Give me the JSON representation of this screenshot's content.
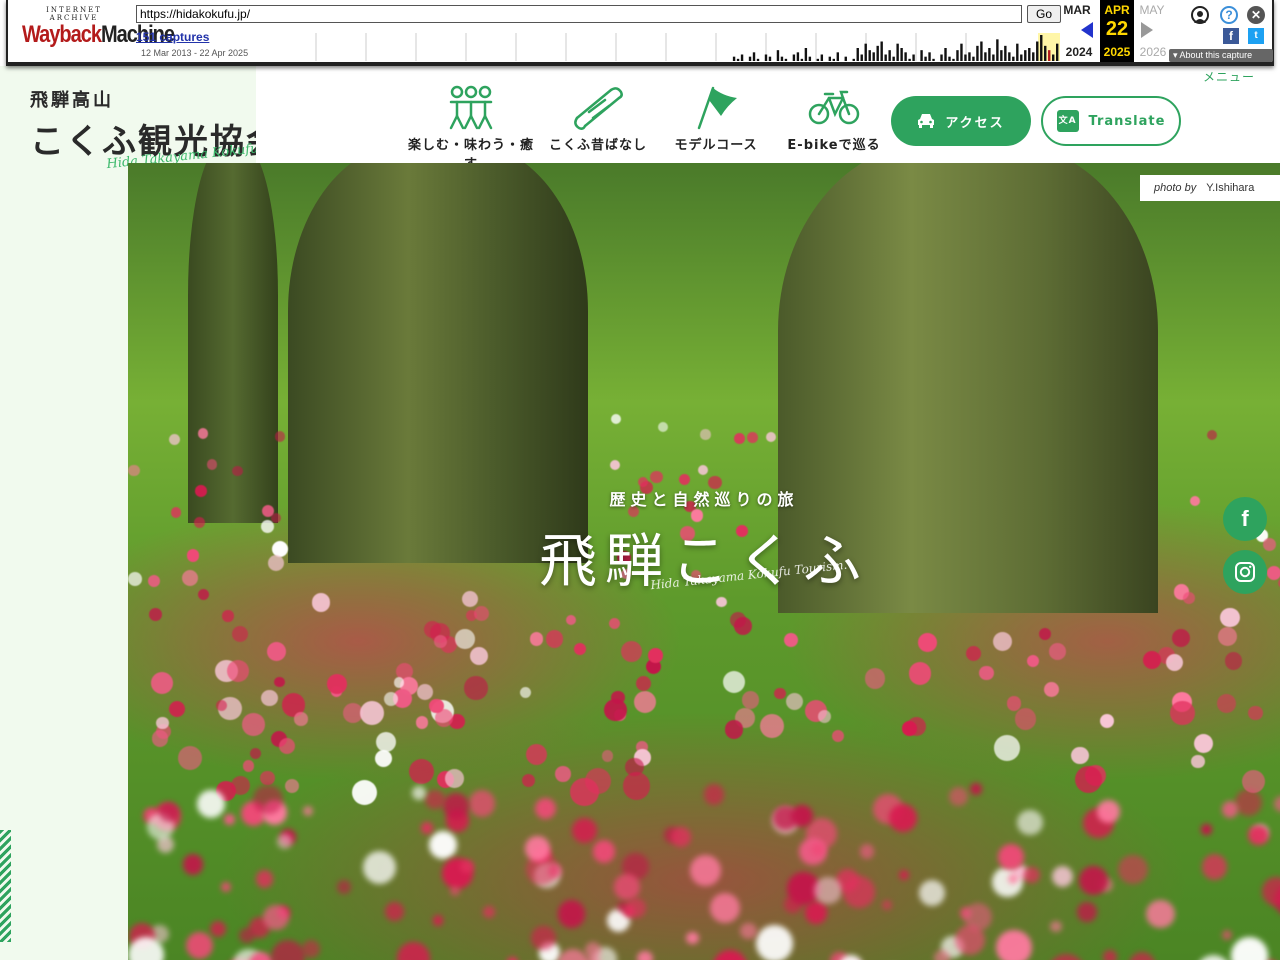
{
  "wayback": {
    "logo_top": "INTERNET ARCHIVE",
    "logo_main_a": "Wayback",
    "logo_main_b": "Machine",
    "url": "https://hidakokufu.jp/",
    "go_label": "Go",
    "captures": "151 captures",
    "range": "12 Mar 2013 - 22 Apr 2025",
    "prev_month": "MAR",
    "cur_month": "APR",
    "next_month": "MAY",
    "prev_year": "2024",
    "cur_year": "2025",
    "next_year": "2026",
    "cur_day": "22",
    "about": "About this capture",
    "sparkline": [
      0,
      0,
      0,
      0,
      0,
      0,
      0,
      0,
      0,
      0,
      0,
      0,
      0,
      0,
      0,
      0,
      0,
      0,
      0,
      0,
      0,
      0,
      0,
      0,
      0,
      0,
      0,
      0,
      0,
      0,
      0,
      0,
      0,
      0,
      0,
      0,
      0,
      0,
      0,
      0,
      0,
      0,
      0,
      0,
      0,
      0,
      0,
      0,
      0,
      0,
      0,
      0,
      0,
      0,
      0,
      0,
      0,
      0,
      0,
      0,
      0,
      0,
      0,
      0,
      0,
      0,
      0,
      0,
      0,
      0,
      0,
      0,
      0,
      0,
      0,
      0,
      0,
      0,
      0,
      0,
      0,
      0,
      0,
      0,
      0,
      0,
      0,
      0,
      0,
      0,
      0,
      0,
      0,
      0,
      0,
      0,
      0,
      0,
      0,
      0,
      0,
      0,
      0,
      0,
      0,
      0,
      2,
      1,
      3,
      0,
      2,
      4,
      1,
      0,
      3,
      2,
      0,
      5,
      2,
      1,
      0,
      3,
      4,
      1,
      6,
      2,
      0,
      1,
      3,
      0,
      2,
      1,
      4,
      0,
      2,
      0,
      1,
      6,
      3,
      8,
      5,
      4,
      7,
      9,
      3,
      5,
      2,
      8,
      6,
      4,
      1,
      3,
      0,
      5,
      2,
      4,
      1,
      0,
      3,
      6,
      2,
      1,
      5,
      8,
      3,
      4,
      2,
      7,
      9,
      4,
      6,
      3,
      10,
      5,
      7,
      4,
      2,
      8,
      3,
      5,
      6,
      4,
      9,
      12,
      7,
      5,
      3,
      8
    ],
    "colors": {
      "accent": "#ffd700",
      "link": "#2233aa",
      "logo_red": "#b31b1b"
    }
  },
  "site": {
    "logo_line1": "飛騨高山",
    "logo_line2": "こくふ観光協会",
    "logo_en": "Hida Takayama Kokufu Tourism.",
    "menu_label": "メニュー",
    "nav": [
      {
        "label": "楽しむ・味わう・癒す",
        "icon": "people-icon"
      },
      {
        "label": "こくふ昔ばなし",
        "icon": "scroll-icon"
      },
      {
        "label": "モデルコース",
        "icon": "flag-icon"
      },
      {
        "label": "E-bikeで巡る",
        "icon": "bicycle-icon"
      }
    ],
    "access_label": "アクセス",
    "translate_label": "Translate",
    "translate_icon_text": "文A",
    "colors": {
      "brand": "#2ea35e",
      "left_strip": "#f1faee"
    }
  },
  "hero": {
    "photo_by_label": "photo by",
    "photo_by_name": "Y.Ishihara",
    "subtitle": "歴史と自然巡りの旅",
    "title": "飛騨こくふ",
    "title_en": "Hida Takayama Kokufu Tourism."
  },
  "sns": {
    "facebook": "f",
    "instagram_icon": "instagram-icon"
  }
}
